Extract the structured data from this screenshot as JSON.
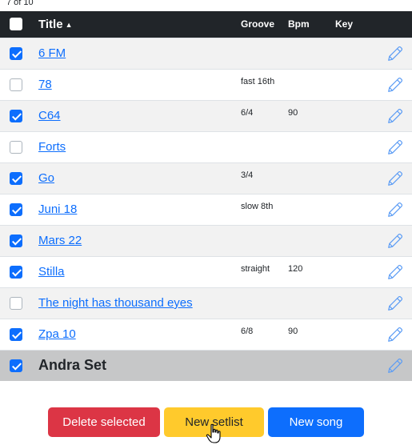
{
  "counter": "7 of 10",
  "header": {
    "title": "Title",
    "sort_icon": "▲",
    "groove": "Groove",
    "bpm": "Bpm",
    "key": "Key"
  },
  "rows": [
    {
      "title": "6 FM",
      "groove": "",
      "bpm": "",
      "key": "",
      "checked": true
    },
    {
      "title": "78",
      "groove": "fast 16th",
      "bpm": "",
      "key": "",
      "checked": false
    },
    {
      "title": "C64",
      "groove": "6/4",
      "bpm": "90",
      "key": "",
      "checked": true
    },
    {
      "title": "Forts",
      "groove": "",
      "bpm": "",
      "key": "",
      "checked": false
    },
    {
      "title": "Go",
      "groove": "3/4",
      "bpm": "",
      "key": "",
      "checked": true
    },
    {
      "title": "Juni 18",
      "groove": "slow 8th",
      "bpm": "",
      "key": "",
      "checked": true
    },
    {
      "title": "Mars 22",
      "groove": "",
      "bpm": "",
      "key": "",
      "checked": true
    },
    {
      "title": "Stilla",
      "groove": "straight",
      "bpm": "120",
      "key": "",
      "checked": true
    },
    {
      "title": "The night has thousand eyes",
      "groove": "",
      "bpm": "",
      "key": "",
      "checked": false
    },
    {
      "title": "Zpa 10",
      "groove": "6/8",
      "bpm": "90",
      "key": "",
      "checked": true
    }
  ],
  "set_row": {
    "title": "Andra Set",
    "checked": true
  },
  "buttons": {
    "delete": "Delete selected",
    "new_setlist": "New setlist",
    "new_song": "New song"
  },
  "colors": {
    "link": "#0d6efd",
    "header_bg": "#212529",
    "set_row_bg": "#c6c7c8",
    "danger": "#dc3545",
    "warning": "#ffca2c",
    "primary": "#0d6efd"
  },
  "icons": {
    "edit": "pencil-icon",
    "sort": "sort-ascending-icon",
    "cursor": "hand-pointer-cursor-icon"
  }
}
